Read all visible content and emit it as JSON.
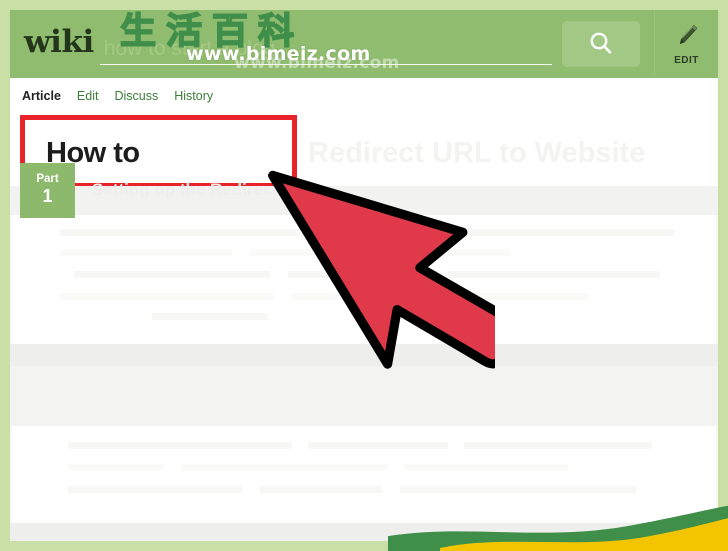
{
  "page": {
    "background_color": "#c9dfa5",
    "sheet_color": "#f7f7f5"
  },
  "header": {
    "background_color": "#8fbc6e",
    "logo": "wiki",
    "search": {
      "value": "",
      "placeholder": "how to start a blog",
      "icon": "search-icon",
      "button_color": "#a2c885"
    },
    "edit": {
      "label": "EDIT",
      "icon": "pencil-icon"
    }
  },
  "nav": {
    "tabs": [
      {
        "label": "Article",
        "active": true
      },
      {
        "label": "Edit",
        "active": false
      },
      {
        "label": "Discuss",
        "active": false
      },
      {
        "label": "History",
        "active": false
      }
    ],
    "active_color": "#222222",
    "link_color": "#3c7d3a"
  },
  "article": {
    "title_visible": "How to",
    "title_ghost": "Redirect URL to Website",
    "highlight_box_color": "#e8232a",
    "part_badge": {
      "word": "Part",
      "number": "1",
      "color": "#8cb96c"
    },
    "part_heading_ghost": "Setting up the Redirect"
  },
  "cursor": {
    "name": "mouse-pointer",
    "fill_color": "#e03a4a",
    "outline_color": "#000000"
  },
  "watermark": {
    "chinese": "生活百科",
    "url": "www.bimeiz.com",
    "echo": "www.bimeiz.com",
    "stroke_color": "#3f8f4a",
    "ribbon_green": "#3f8f4a",
    "ribbon_yellow": "#f2c500"
  }
}
